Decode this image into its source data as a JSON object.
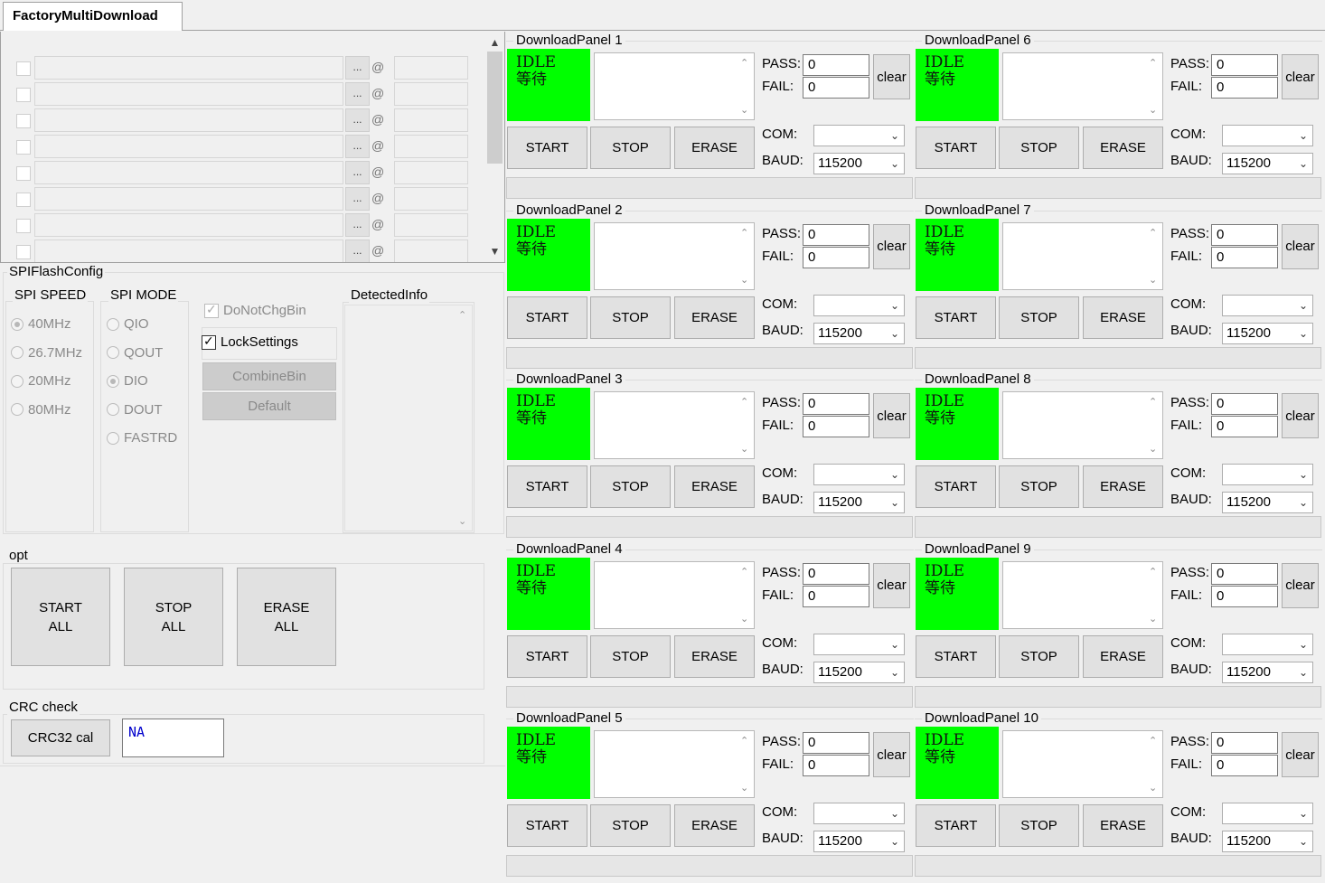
{
  "tab": {
    "title": "FactoryMultiDownload"
  },
  "binlist": {
    "rows": [
      {
        "dots": "...",
        "at": "@"
      },
      {
        "dots": "...",
        "at": "@"
      },
      {
        "dots": "...",
        "at": "@"
      },
      {
        "dots": "...",
        "at": "@"
      },
      {
        "dots": "...",
        "at": "@"
      },
      {
        "dots": "...",
        "at": "@"
      },
      {
        "dots": "...",
        "at": "@"
      },
      {
        "dots": "...",
        "at": "@"
      }
    ]
  },
  "spiflash": {
    "title": "SPIFlashConfig",
    "speed": {
      "title": "SPI SPEED",
      "options": [
        "40MHz",
        "26.7MHz",
        "20MHz",
        "80MHz"
      ],
      "selected": "40MHz"
    },
    "mode": {
      "title": "SPI MODE",
      "options": [
        "QIO",
        "QOUT",
        "DIO",
        "DOUT",
        "FASTRD"
      ],
      "selected": "DIO"
    },
    "donotchgbin": "DoNotChgBin",
    "locksettings": "LockSettings",
    "combinebin": "CombineBin",
    "default": "Default",
    "detected_title": "DetectedInfo"
  },
  "opt": {
    "title": "opt",
    "start_l1": "START",
    "start_l2": "ALL",
    "stop_l1": "STOP",
    "stop_l2": "ALL",
    "erase_l1": "ERASE",
    "erase_l2": "ALL"
  },
  "crc": {
    "title": "CRC check",
    "button": "CRC32 cal",
    "value": "NA"
  },
  "colors": {
    "status_idle": "#00ff00",
    "crc_value_text": "#0000cc"
  },
  "panel_labels": {
    "status_l1": "IDLE",
    "status_l2": "等待",
    "pass": "PASS:",
    "fail": "FAIL:",
    "clear": "clear",
    "start": "START",
    "stop": "STOP",
    "erase": "ERASE",
    "com": "COM:",
    "baud": "BAUD:"
  },
  "panels": [
    {
      "title": "DownloadPanel 1",
      "pass": "0",
      "fail": "0",
      "com": "",
      "baud": "115200"
    },
    {
      "title": "DownloadPanel 2",
      "pass": "0",
      "fail": "0",
      "com": "",
      "baud": "115200"
    },
    {
      "title": "DownloadPanel 3",
      "pass": "0",
      "fail": "0",
      "com": "",
      "baud": "115200"
    },
    {
      "title": "DownloadPanel 4",
      "pass": "0",
      "fail": "0",
      "com": "",
      "baud": "115200"
    },
    {
      "title": "DownloadPanel 5",
      "pass": "0",
      "fail": "0",
      "com": "",
      "baud": "115200"
    },
    {
      "title": "DownloadPanel 6",
      "pass": "0",
      "fail": "0",
      "com": "",
      "baud": "115200"
    },
    {
      "title": "DownloadPanel 7",
      "pass": "0",
      "fail": "0",
      "com": "",
      "baud": "115200"
    },
    {
      "title": "DownloadPanel 8",
      "pass": "0",
      "fail": "0",
      "com": "",
      "baud": "115200"
    },
    {
      "title": "DownloadPanel 9",
      "pass": "0",
      "fail": "0",
      "com": "",
      "baud": "115200"
    },
    {
      "title": "DownloadPanel 10",
      "pass": "0",
      "fail": "0",
      "com": "",
      "baud": "115200"
    }
  ]
}
